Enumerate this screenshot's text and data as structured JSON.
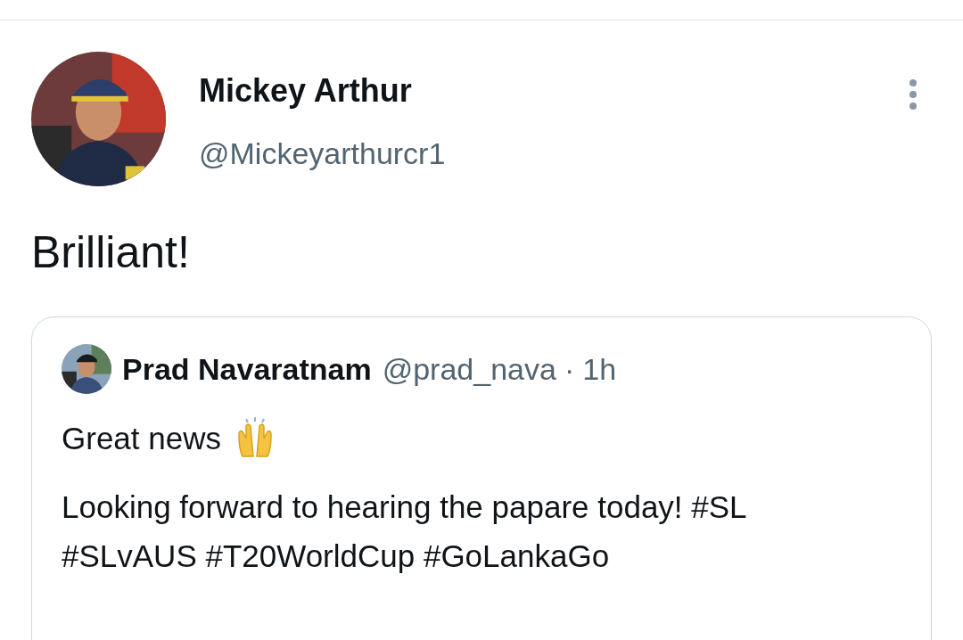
{
  "author": {
    "name": "Mickey Arthur",
    "handle": "@Mickeyarthurcr1"
  },
  "text": "Brilliant!",
  "quoted": {
    "name": "Prad Navaratnam",
    "handle": "@prad_nava",
    "separator": "·",
    "time": "1h",
    "paragraphs": [
      "Great news",
      "Looking forward to hearing the papare today! #SL\n#SLvAUS #T20WorldCup #GoLankaGo"
    ]
  }
}
